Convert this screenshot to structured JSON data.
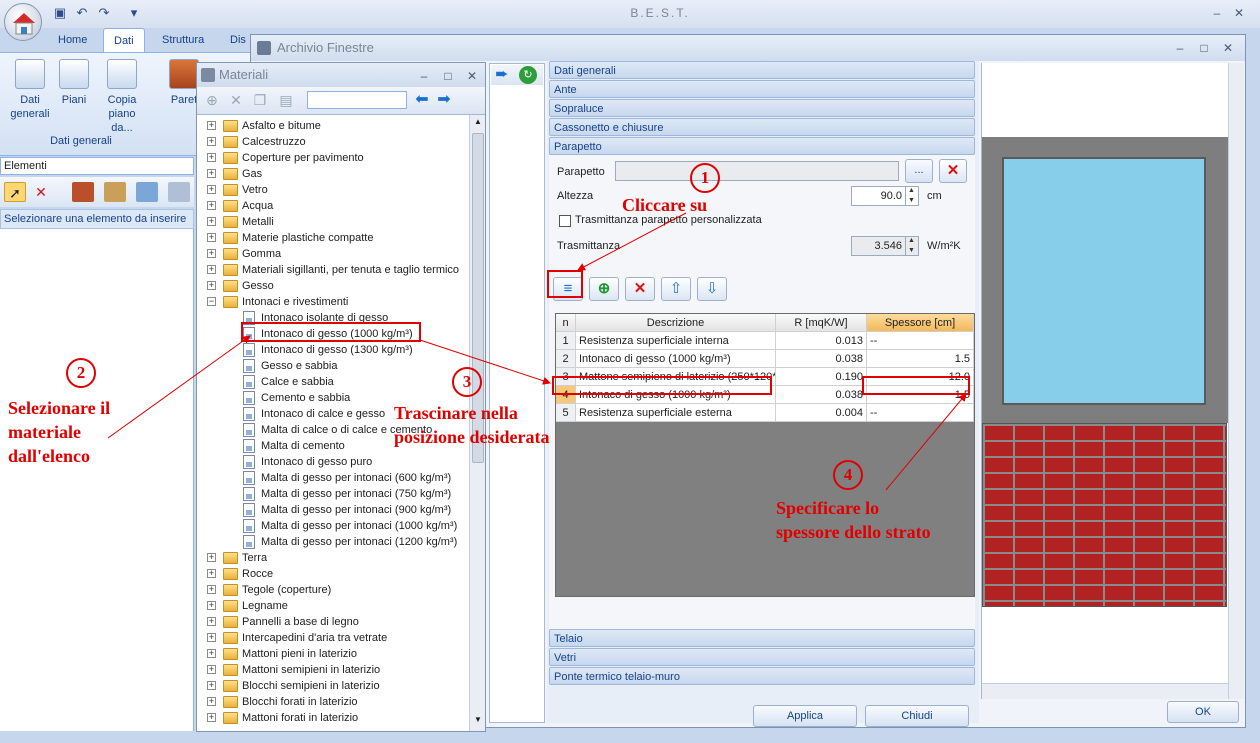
{
  "app": {
    "title": "B.E.S.T.",
    "ribbon_tabs": [
      "Home",
      "Dati",
      "Struttura",
      "Dis"
    ],
    "ribbon_buttons": [
      {
        "label": "Dati\ngenerali",
        "icon": "edit-document-icon"
      },
      {
        "label": "Piani",
        "icon": "layers-icon"
      },
      {
        "label": "Copia\npiano da...",
        "icon": "copy-icon"
      },
      {
        "label": "Paret",
        "icon": "wall-icon"
      }
    ],
    "ribbon_group_label": "Dati generali"
  },
  "elementi": {
    "combo_value": "Elementi",
    "hint": "Selezionare una elemento da inserire"
  },
  "materiali": {
    "title": "Materiali",
    "tree": [
      {
        "label": "Asfalto e bitume",
        "type": "folder",
        "expander": "+"
      },
      {
        "label": "Calcestruzzo",
        "type": "folder",
        "expander": "+"
      },
      {
        "label": "Coperture per pavimento",
        "type": "folder",
        "expander": "+"
      },
      {
        "label": "Gas",
        "type": "folder",
        "expander": "+"
      },
      {
        "label": "Vetro",
        "type": "folder",
        "expander": "+"
      },
      {
        "label": "Acqua",
        "type": "folder",
        "expander": "+"
      },
      {
        "label": "Metalli",
        "type": "folder",
        "expander": "+"
      },
      {
        "label": "Materie plastiche compatte",
        "type": "folder",
        "expander": "+"
      },
      {
        "label": "Gomma",
        "type": "folder",
        "expander": "+"
      },
      {
        "label": "Materiali sigillanti, per tenuta e taglio termico",
        "type": "folder",
        "expander": "+"
      },
      {
        "label": "Gesso",
        "type": "folder",
        "expander": "+"
      },
      {
        "label": "Intonaci e rivestimenti",
        "type": "folder",
        "expander": "−"
      },
      {
        "label": "Intonaco isolante di gesso",
        "type": "item"
      },
      {
        "label": "Intonaco di gesso (1000 kg/m³)",
        "type": "item",
        "highlight": true
      },
      {
        "label": "Intonaco di gesso (1300 kg/m³)",
        "type": "item"
      },
      {
        "label": "Gesso e sabbia",
        "type": "item"
      },
      {
        "label": "Calce e sabbia",
        "type": "item"
      },
      {
        "label": "Cemento e sabbia",
        "type": "item"
      },
      {
        "label": "Intonaco di calce e gesso",
        "type": "item"
      },
      {
        "label": "Malta di calce o di calce e cemento",
        "type": "item"
      },
      {
        "label": "Malta di cemento",
        "type": "item"
      },
      {
        "label": "Intonaco di gesso puro",
        "type": "item"
      },
      {
        "label": "Malta di gesso per intonaci (600 kg/m³)",
        "type": "item"
      },
      {
        "label": "Malta di gesso per intonaci (750 kg/m³)",
        "type": "item"
      },
      {
        "label": "Malta di gesso per intonaci (900 kg/m³)",
        "type": "item"
      },
      {
        "label": "Malta di gesso per intonaci (1000 kg/m³)",
        "type": "item"
      },
      {
        "label": "Malta di gesso per intonaci (1200 kg/m³)",
        "type": "item"
      },
      {
        "label": "Terra",
        "type": "folder",
        "expander": "+"
      },
      {
        "label": "Rocce",
        "type": "folder",
        "expander": "+"
      },
      {
        "label": "Tegole (coperture)",
        "type": "folder",
        "expander": "+"
      },
      {
        "label": "Legname",
        "type": "folder",
        "expander": "+"
      },
      {
        "label": "Pannelli a base di legno",
        "type": "folder",
        "expander": "+"
      },
      {
        "label": "Intercapedini d'aria tra vetrate",
        "type": "folder",
        "expander": "+"
      },
      {
        "label": "Mattoni pieni in laterizio",
        "type": "folder",
        "expander": "+"
      },
      {
        "label": "Mattoni semipieni in laterizio",
        "type": "folder",
        "expander": "+"
      },
      {
        "label": "Blocchi semipieni in laterizio",
        "type": "folder",
        "expander": "+"
      },
      {
        "label": "Blocchi forati in laterizio",
        "type": "folder",
        "expander": "+"
      },
      {
        "label": "Mattoni forati in laterizio",
        "type": "folder",
        "expander": "+"
      }
    ]
  },
  "archivio": {
    "title": "Archivio Finestre",
    "sections_top": [
      "Dati generali",
      "Ante",
      "Sopraluce",
      "Cassonetto e chiusure",
      "Parapetto"
    ],
    "sections_bottom": [
      "Telaio",
      "Vetri",
      "Ponte termico telaio-muro"
    ],
    "parapetto": {
      "label": "Parapetto",
      "browse": "...",
      "altezza_label": "Altezza",
      "altezza_value": "90.0",
      "altezza_unit": "cm",
      "checkbox_label": "Trasmittanza parapetto personalizzata",
      "trasmittanza_label": "Trasmittanza",
      "trasmittanza_value": "3.546",
      "trasmittanza_unit": "W/m²K"
    },
    "grid": {
      "headers": [
        "n",
        "Descrizione",
        "R [mqK/W]",
        "Spessore [cm]"
      ],
      "rows": [
        [
          "1",
          "Resistenza superficiale interna",
          "0.013",
          "--"
        ],
        [
          "2",
          "Intonaco di gesso (1000 kg/m³)",
          "0.038",
          "1.5"
        ],
        [
          "3",
          "Mattone semipieno di laterizio (250*120*",
          "0.190",
          "12.0"
        ],
        [
          "4",
          "Intonaco di gesso (1000 kg/m³)",
          "0.038",
          "1.5"
        ],
        [
          "5",
          "Resistenza superficiale esterna",
          "0.004",
          "--"
        ]
      ]
    },
    "buttons": {
      "applica": "Applica",
      "chiudi": "Chiudi",
      "ok": "OK"
    }
  },
  "annotations": {
    "step1_num": "1",
    "step1_text": "Cliccare  su",
    "step2_num": "2",
    "step2_text": [
      "Selezionare il",
      "materiale",
      "dall'elenco"
    ],
    "step3_num": "3",
    "step3_text": [
      "Trascinare nella",
      "posizione desiderata"
    ],
    "step4_num": "4",
    "step4_text": [
      "Specificare lo",
      "spessore dello strato"
    ],
    "color": "#e00000"
  }
}
